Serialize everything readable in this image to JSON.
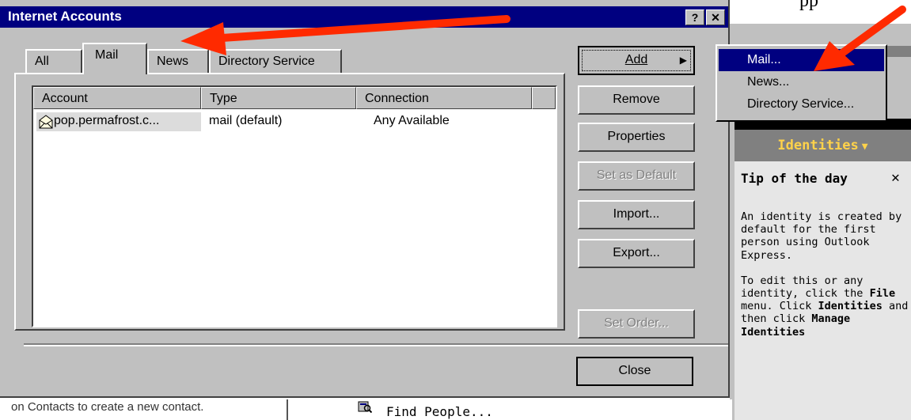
{
  "background": {
    "top_fragment": "pp",
    "identities_label": "Identities",
    "tip": {
      "title": "Tip of the day",
      "close_glyph": "✕",
      "paragraph1": "An identity is created by default for the first person using Outlook Express.",
      "paragraph2_parts": [
        "To edit this or any identity, click the ",
        "File",
        " menu. Click ",
        "Identities",
        " and then click ",
        "Manage",
        " ",
        "Identities"
      ]
    },
    "bottom_left_text": "on Contacts to create a new contact.",
    "find_people": "Find People..."
  },
  "dialog": {
    "title": "Internet Accounts",
    "title_buttons": [
      "?",
      "✕"
    ],
    "tabs": [
      {
        "label": "All",
        "active": false
      },
      {
        "label": "Mail",
        "active": true
      },
      {
        "label": "News",
        "active": false
      },
      {
        "label": "Directory Service",
        "active": false
      }
    ],
    "list": {
      "columns": [
        "Account",
        "Type",
        "Connection",
        ""
      ],
      "rows": [
        {
          "account": "pop.permafrost.c...",
          "type": "mail (default)",
          "connection": "Any Available"
        }
      ]
    },
    "buttons": {
      "add": {
        "label": "Add",
        "arrow": "▶"
      },
      "remove": "Remove",
      "properties": "Properties",
      "set_default": "Set as Default",
      "import": "Import...",
      "export": "Export...",
      "set_order": "Set Order...",
      "close": "Close"
    }
  },
  "add_menu": {
    "items": [
      {
        "label": "Mail...",
        "selected": true
      },
      {
        "label": "News...",
        "selected": false
      },
      {
        "label": "Directory Service...",
        "selected": false
      }
    ]
  },
  "colors": {
    "titlebar": "#000080",
    "arrow": "#ff2a00",
    "identities_text": "#ffd24a"
  }
}
